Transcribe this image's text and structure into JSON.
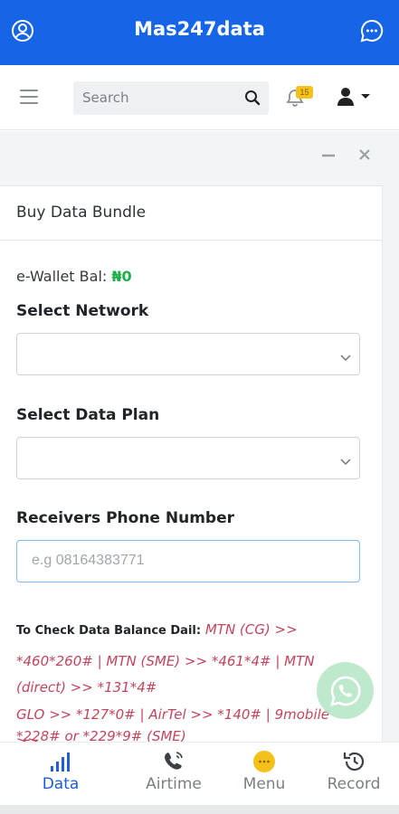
{
  "app": {
    "title": "Mas247data"
  },
  "topbar": {
    "search_placeholder": "Search",
    "notification_count": "15"
  },
  "card": {
    "title": "Buy Data Bundle",
    "wallet_label": "e-Wallet Bal:",
    "wallet_value": "₦0",
    "network_label": "Select Network",
    "network_value": "",
    "plan_label": "Select Data Plan",
    "plan_value": "",
    "phone_label": "Receivers Phone Number",
    "phone_placeholder": "e.g 08164383771",
    "info_heading": "To Check Data Balance Dail:",
    "info_lines": [
      "MTN (CG) >>",
      "*460*260# | MTN (SME) >> *461*4# | MTN",
      "(direct) >> *131*4#",
      "GLO >> *127*0# | AirTel >> *140# | 9mobile >>",
      "*228# or *229*9# (SME)"
    ]
  },
  "bottom_nav": [
    {
      "label": "Data",
      "icon": "signal-bars-icon",
      "active": true
    },
    {
      "label": "Airtime",
      "icon": "phone-ringing-icon",
      "active": false
    },
    {
      "label": "Menu",
      "icon": "menu-dots-icon",
      "active": false
    },
    {
      "label": "Record",
      "icon": "history-icon",
      "active": false
    }
  ],
  "colors": {
    "primary": "#1565e6",
    "wallet_green": "#20b04a",
    "info_red": "#c2455d",
    "badge": "#f4c21b"
  }
}
